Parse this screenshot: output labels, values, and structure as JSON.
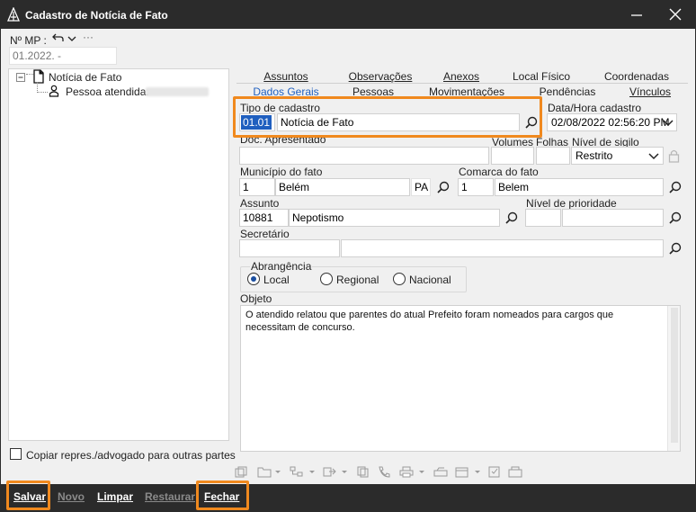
{
  "window": {
    "title": "Cadastro de Notícia de Fato"
  },
  "header": {
    "num_mp_label": "Nº MP :",
    "num_mp_value": "01.2022.          -",
    "ellipsis": "···"
  },
  "tree": {
    "root_label": "Notícia de Fato",
    "child_label": "Pessoa atendida:"
  },
  "copy_checkbox_label": "Copiar repres./advogado para outras partes",
  "tabs_row1": [
    "Assuntos",
    "Observações",
    "Anexos",
    "Local Físico",
    "Coordenadas"
  ],
  "tabs_row2": [
    "Dados Gerais",
    "Pessoas",
    "Movimentações",
    "Pendências",
    "Vínculos"
  ],
  "form": {
    "tipo_cadastro_label": "Tipo de cadastro",
    "tipo_code": "01.01",
    "tipo_name": "Notícia de Fato",
    "data_hora_label": "Data/Hora cadastro",
    "data_hora_value": "02/08/2022 02:56:20 PM",
    "doc_apresentado_label": "Doc. Apresentado",
    "volumes_label": "Volumes",
    "folhas_label": "Folhas",
    "nivel_sigilo_label": "Nível de sigilo",
    "nivel_sigilo_value": "Restrito",
    "municipio_label": "Município do fato",
    "municipio_code": "1",
    "municipio_name": "Belém",
    "municipio_uf": "PA",
    "comarca_label": "Comarca do fato",
    "comarca_code": "1",
    "comarca_name": "Belem",
    "assunto_label": "Assunto",
    "assunto_code": "10881",
    "assunto_name": "Nepotismo",
    "nivel_prioridade_label": "Nível de prioridade",
    "secretario_label": "Secretário",
    "abrangencia_label": "Abrangência",
    "abrangencia_options": [
      "Local",
      "Regional",
      "Nacional"
    ],
    "abrangencia_selected": "Local",
    "objeto_label": "Objeto",
    "objeto_text": "O atendido relatou que parentes do atual Prefeito foram nomeados para cargos que necessitam de concurso."
  },
  "bottom": {
    "salvar": "Salvar",
    "novo": "Novo",
    "limpar": "Limpar",
    "restaurar": "Restaurar",
    "fechar": "Fechar"
  },
  "colors": {
    "highlight": "#f0891e",
    "titlebar": "#2b2b2b",
    "selection": "#1f5fbf"
  }
}
